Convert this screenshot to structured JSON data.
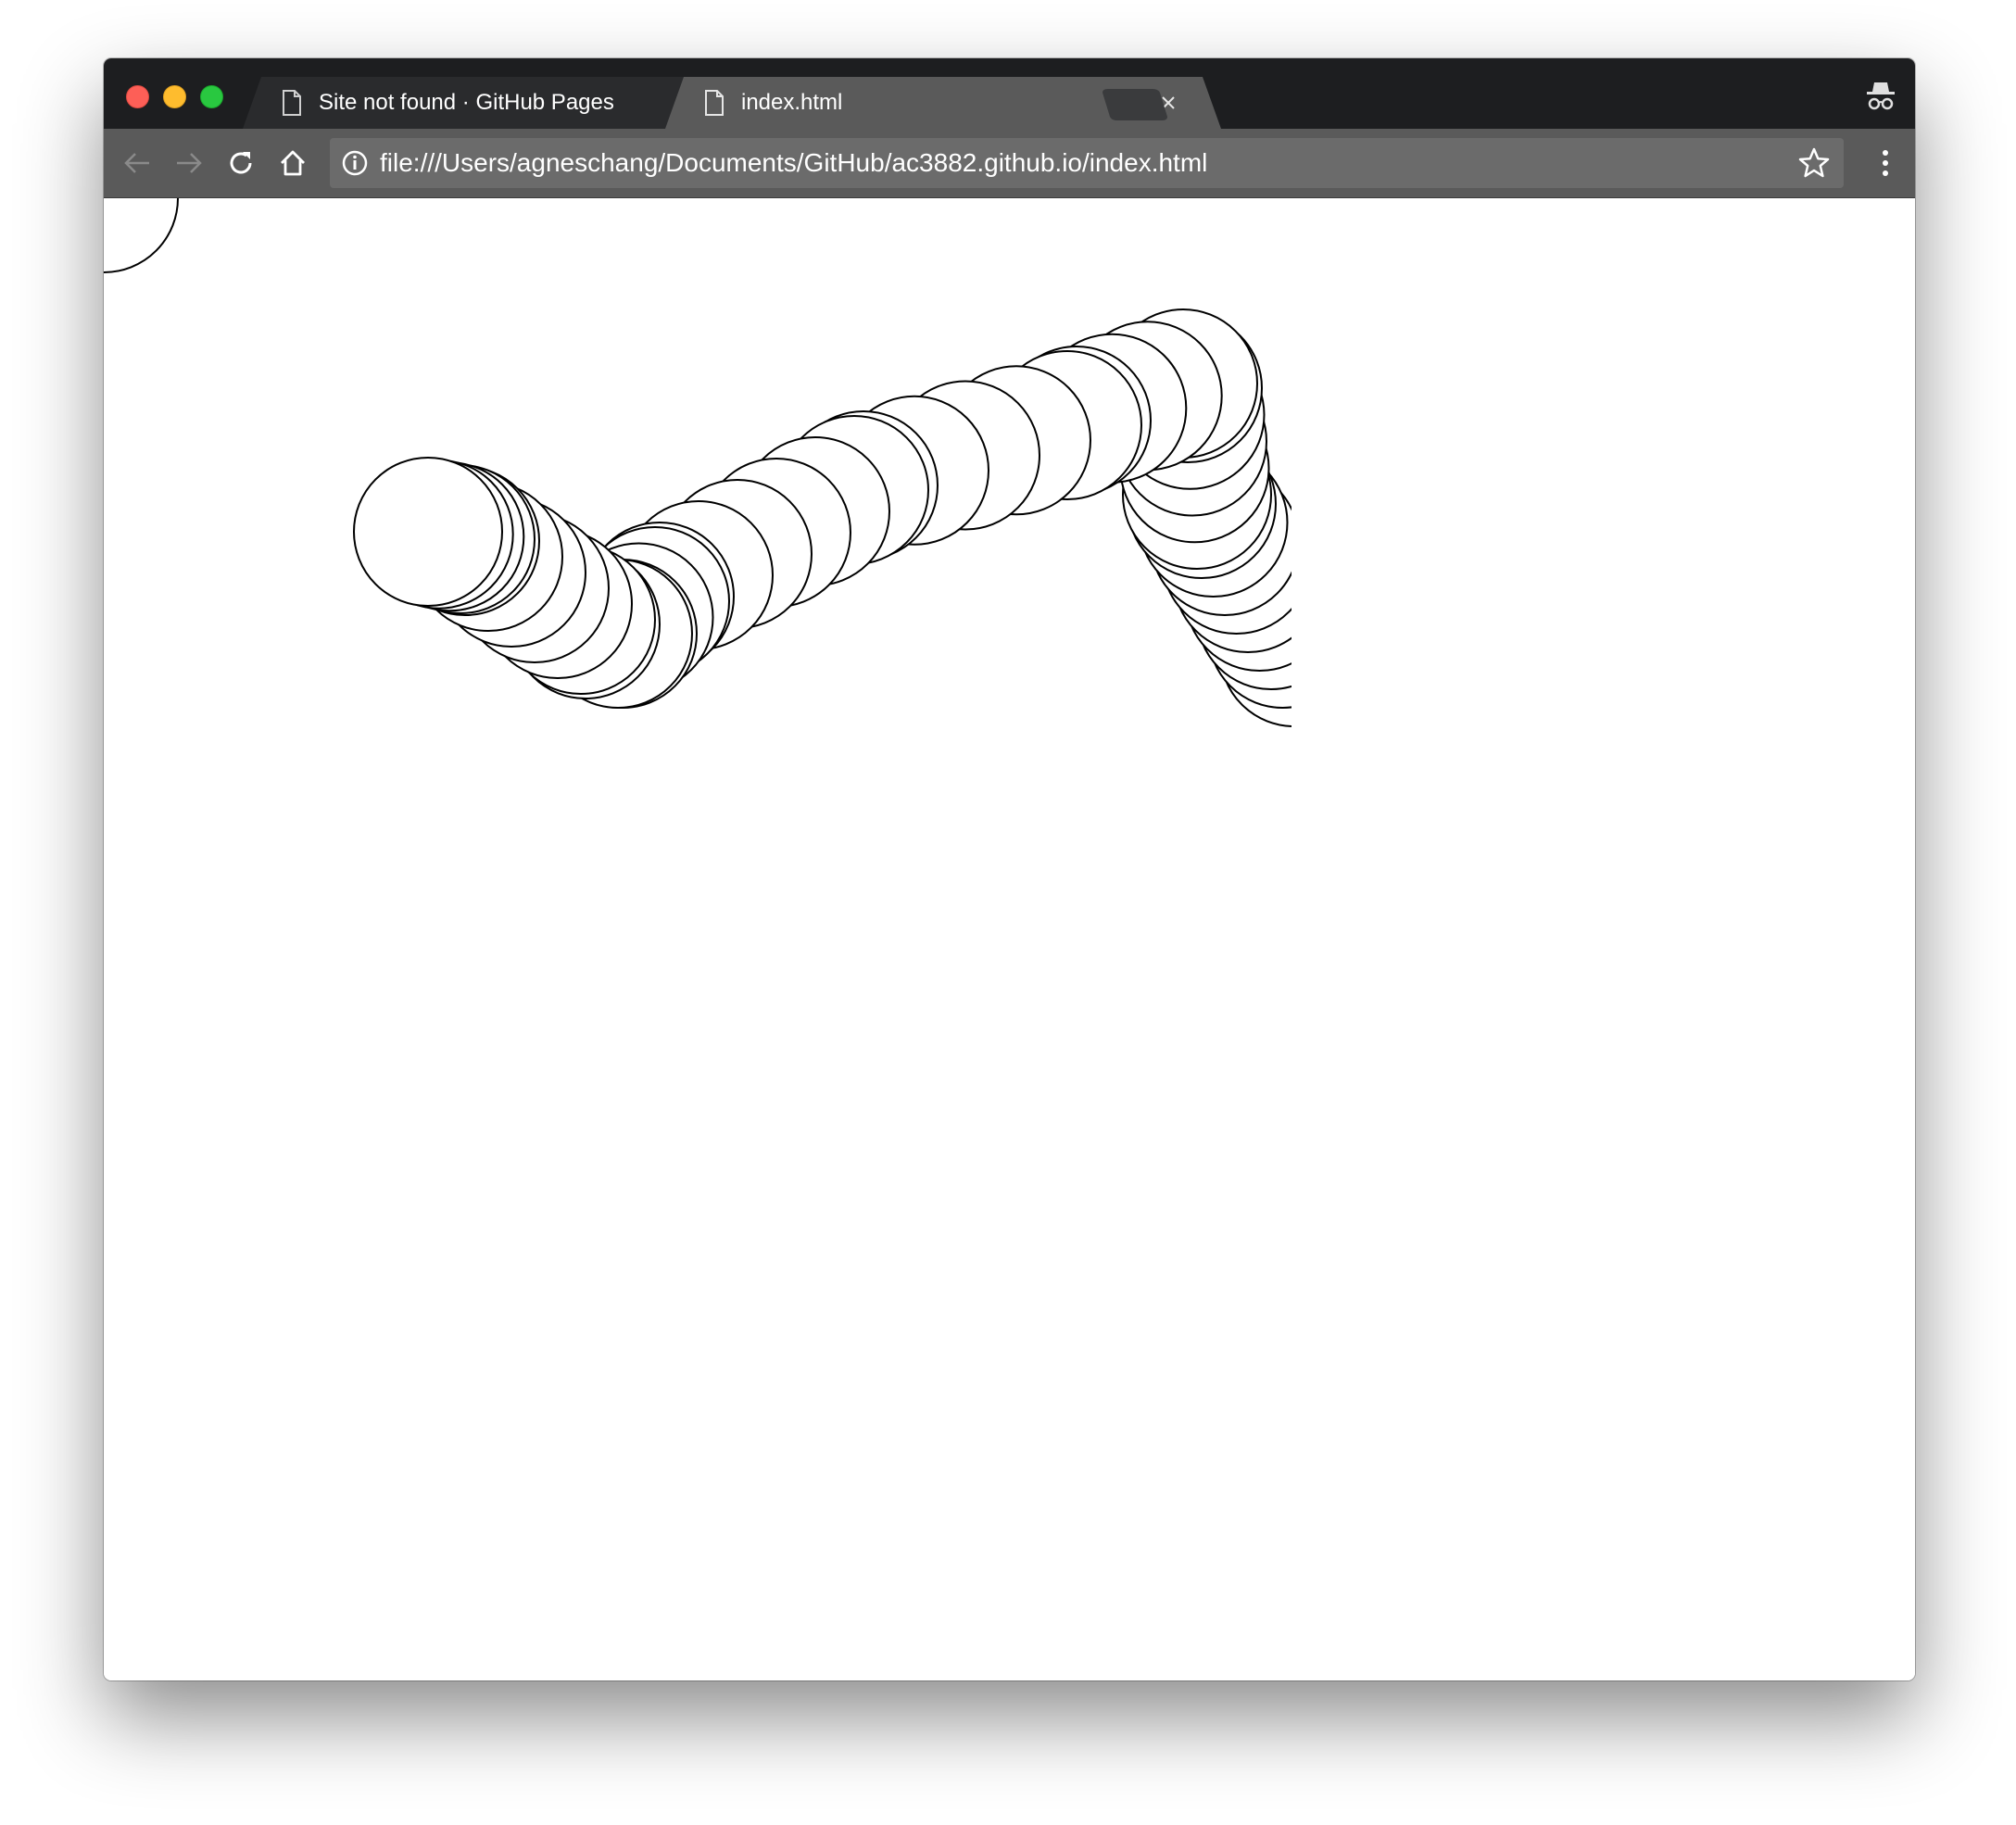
{
  "window": {
    "tabs": [
      {
        "title": "Site not found · GitHub Pages",
        "icon": "document-icon",
        "active": false
      },
      {
        "title": "index.html",
        "icon": "document-icon",
        "active": true
      }
    ],
    "incognito": true
  },
  "toolbar": {
    "url": "file:///Users/agneschang/Documents/GitHub/ac3882.github.io/index.html",
    "icons": [
      "back-arrow-icon",
      "forward-arrow-icon",
      "reload-icon",
      "home-icon",
      "info-icon",
      "star-icon",
      "menu-dots-icon"
    ]
  },
  "page": {
    "background": "#ffffff",
    "stroke_color": "#000000",
    "content": "circle trail drawing"
  }
}
